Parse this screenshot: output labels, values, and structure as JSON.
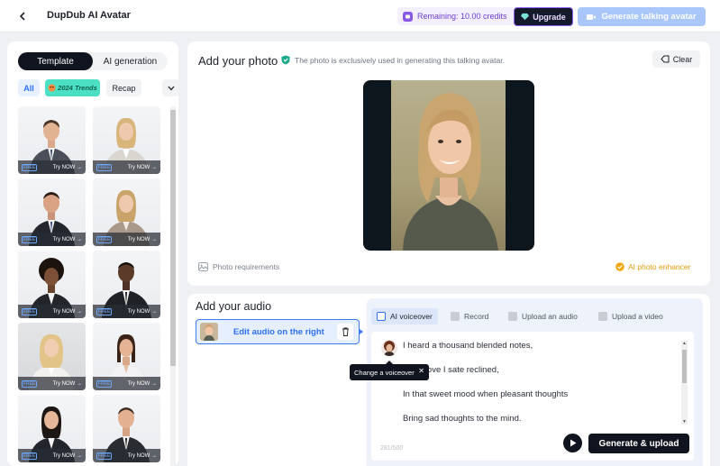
{
  "header": {
    "title": "DupDub AI Avatar",
    "credits": "Remaining: 10.00 credits",
    "upgrade_label": "Upgrade",
    "generate_label": "Generate talking avatar"
  },
  "left_panel": {
    "tabs": [
      "Template",
      "AI generation"
    ],
    "filters": {
      "all": "All",
      "trends": "2024 Trends",
      "recap": "Recap"
    },
    "card_tag": "FREE",
    "card_cta": "Try NOW →"
  },
  "photo": {
    "title": "Add your photo",
    "note": "The photo is exclusively used in generating this talking avatar.",
    "clear_label": "Clear",
    "requirements_label": "Photo requirements",
    "enhancer_label": "AI photo enhancer"
  },
  "audio": {
    "title": "Add your audio",
    "edit_label": "Edit audio on the right",
    "tabs": [
      "AI voiceover",
      "Record",
      "Upload an audio",
      "Upload a video"
    ],
    "lines": [
      "I heard a thousand blended notes,",
      "In a grove I sate reclined,",
      "In that sweet mood when pleasant thoughts",
      "Bring sad thoughts to the mind."
    ],
    "char_count": "281/500",
    "generate_upload_label": "Generate & upload",
    "tooltip": "Change a voiceover"
  },
  "colors": {
    "accent": "#2b6ff5",
    "dark": "#10141f",
    "enhancer": "#e39b0a",
    "trend_chip": "#4be0c4"
  }
}
